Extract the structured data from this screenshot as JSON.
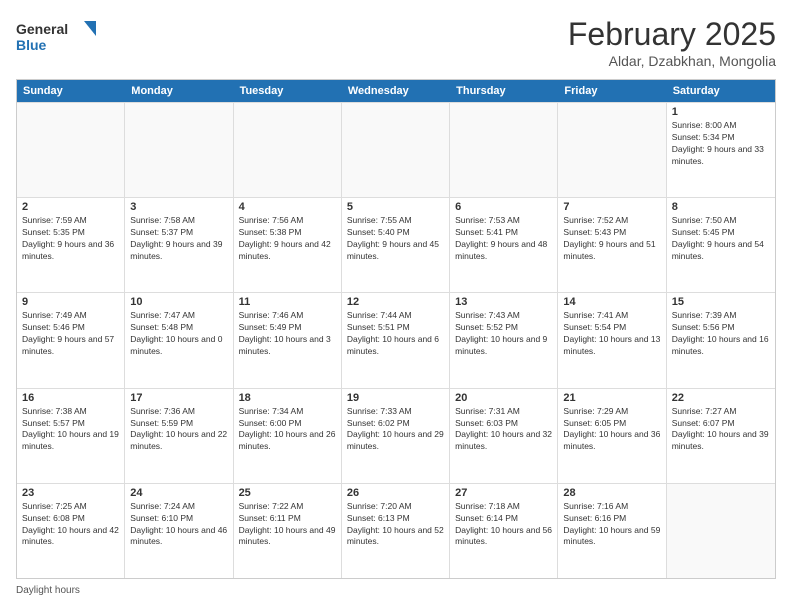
{
  "header": {
    "logo_line1": "General",
    "logo_line2": "Blue",
    "month_title": "February 2025",
    "location": "Aldar, Dzabkhan, Mongolia"
  },
  "days_of_week": [
    "Sunday",
    "Monday",
    "Tuesday",
    "Wednesday",
    "Thursday",
    "Friday",
    "Saturday"
  ],
  "weeks": [
    [
      {
        "day": "",
        "info": ""
      },
      {
        "day": "",
        "info": ""
      },
      {
        "day": "",
        "info": ""
      },
      {
        "day": "",
        "info": ""
      },
      {
        "day": "",
        "info": ""
      },
      {
        "day": "",
        "info": ""
      },
      {
        "day": "1",
        "info": "Sunrise: 8:00 AM\nSunset: 5:34 PM\nDaylight: 9 hours and 33 minutes."
      }
    ],
    [
      {
        "day": "2",
        "info": "Sunrise: 7:59 AM\nSunset: 5:35 PM\nDaylight: 9 hours and 36 minutes."
      },
      {
        "day": "3",
        "info": "Sunrise: 7:58 AM\nSunset: 5:37 PM\nDaylight: 9 hours and 39 minutes."
      },
      {
        "day": "4",
        "info": "Sunrise: 7:56 AM\nSunset: 5:38 PM\nDaylight: 9 hours and 42 minutes."
      },
      {
        "day": "5",
        "info": "Sunrise: 7:55 AM\nSunset: 5:40 PM\nDaylight: 9 hours and 45 minutes."
      },
      {
        "day": "6",
        "info": "Sunrise: 7:53 AM\nSunset: 5:41 PM\nDaylight: 9 hours and 48 minutes."
      },
      {
        "day": "7",
        "info": "Sunrise: 7:52 AM\nSunset: 5:43 PM\nDaylight: 9 hours and 51 minutes."
      },
      {
        "day": "8",
        "info": "Sunrise: 7:50 AM\nSunset: 5:45 PM\nDaylight: 9 hours and 54 minutes."
      }
    ],
    [
      {
        "day": "9",
        "info": "Sunrise: 7:49 AM\nSunset: 5:46 PM\nDaylight: 9 hours and 57 minutes."
      },
      {
        "day": "10",
        "info": "Sunrise: 7:47 AM\nSunset: 5:48 PM\nDaylight: 10 hours and 0 minutes."
      },
      {
        "day": "11",
        "info": "Sunrise: 7:46 AM\nSunset: 5:49 PM\nDaylight: 10 hours and 3 minutes."
      },
      {
        "day": "12",
        "info": "Sunrise: 7:44 AM\nSunset: 5:51 PM\nDaylight: 10 hours and 6 minutes."
      },
      {
        "day": "13",
        "info": "Sunrise: 7:43 AM\nSunset: 5:52 PM\nDaylight: 10 hours and 9 minutes."
      },
      {
        "day": "14",
        "info": "Sunrise: 7:41 AM\nSunset: 5:54 PM\nDaylight: 10 hours and 13 minutes."
      },
      {
        "day": "15",
        "info": "Sunrise: 7:39 AM\nSunset: 5:56 PM\nDaylight: 10 hours and 16 minutes."
      }
    ],
    [
      {
        "day": "16",
        "info": "Sunrise: 7:38 AM\nSunset: 5:57 PM\nDaylight: 10 hours and 19 minutes."
      },
      {
        "day": "17",
        "info": "Sunrise: 7:36 AM\nSunset: 5:59 PM\nDaylight: 10 hours and 22 minutes."
      },
      {
        "day": "18",
        "info": "Sunrise: 7:34 AM\nSunset: 6:00 PM\nDaylight: 10 hours and 26 minutes."
      },
      {
        "day": "19",
        "info": "Sunrise: 7:33 AM\nSunset: 6:02 PM\nDaylight: 10 hours and 29 minutes."
      },
      {
        "day": "20",
        "info": "Sunrise: 7:31 AM\nSunset: 6:03 PM\nDaylight: 10 hours and 32 minutes."
      },
      {
        "day": "21",
        "info": "Sunrise: 7:29 AM\nSunset: 6:05 PM\nDaylight: 10 hours and 36 minutes."
      },
      {
        "day": "22",
        "info": "Sunrise: 7:27 AM\nSunset: 6:07 PM\nDaylight: 10 hours and 39 minutes."
      }
    ],
    [
      {
        "day": "23",
        "info": "Sunrise: 7:25 AM\nSunset: 6:08 PM\nDaylight: 10 hours and 42 minutes."
      },
      {
        "day": "24",
        "info": "Sunrise: 7:24 AM\nSunset: 6:10 PM\nDaylight: 10 hours and 46 minutes."
      },
      {
        "day": "25",
        "info": "Sunrise: 7:22 AM\nSunset: 6:11 PM\nDaylight: 10 hours and 49 minutes."
      },
      {
        "day": "26",
        "info": "Sunrise: 7:20 AM\nSunset: 6:13 PM\nDaylight: 10 hours and 52 minutes."
      },
      {
        "day": "27",
        "info": "Sunrise: 7:18 AM\nSunset: 6:14 PM\nDaylight: 10 hours and 56 minutes."
      },
      {
        "day": "28",
        "info": "Sunrise: 7:16 AM\nSunset: 6:16 PM\nDaylight: 10 hours and 59 minutes."
      },
      {
        "day": "",
        "info": ""
      }
    ]
  ],
  "footer": {
    "daylight_hours": "Daylight hours"
  }
}
